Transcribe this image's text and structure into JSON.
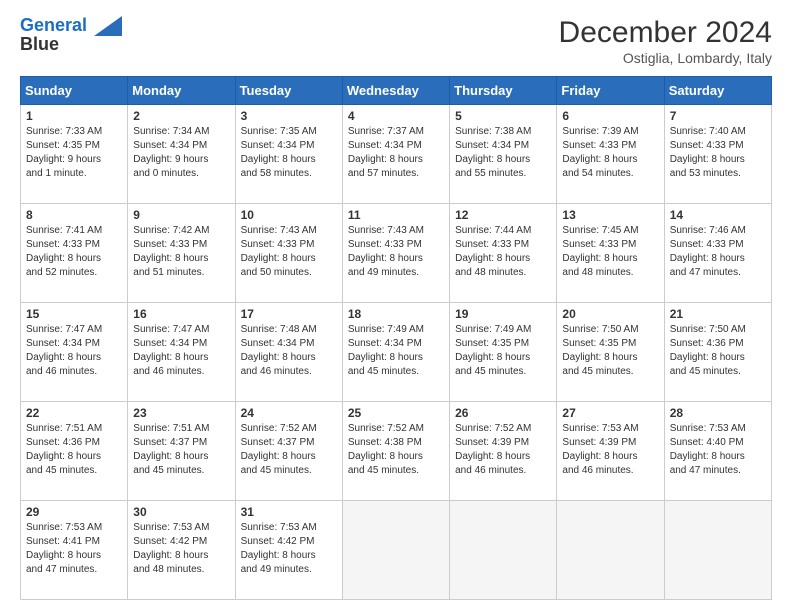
{
  "header": {
    "logo_line1": "General",
    "logo_line2": "Blue",
    "month": "December 2024",
    "location": "Ostiglia, Lombardy, Italy"
  },
  "weekdays": [
    "Sunday",
    "Monday",
    "Tuesday",
    "Wednesday",
    "Thursday",
    "Friday",
    "Saturday"
  ],
  "weeks": [
    [
      {
        "day": "1",
        "lines": [
          "Sunrise: 7:33 AM",
          "Sunset: 4:35 PM",
          "Daylight: 9 hours",
          "and 1 minute."
        ]
      },
      {
        "day": "2",
        "lines": [
          "Sunrise: 7:34 AM",
          "Sunset: 4:34 PM",
          "Daylight: 9 hours",
          "and 0 minutes."
        ]
      },
      {
        "day": "3",
        "lines": [
          "Sunrise: 7:35 AM",
          "Sunset: 4:34 PM",
          "Daylight: 8 hours",
          "and 58 minutes."
        ]
      },
      {
        "day": "4",
        "lines": [
          "Sunrise: 7:37 AM",
          "Sunset: 4:34 PM",
          "Daylight: 8 hours",
          "and 57 minutes."
        ]
      },
      {
        "day": "5",
        "lines": [
          "Sunrise: 7:38 AM",
          "Sunset: 4:34 PM",
          "Daylight: 8 hours",
          "and 55 minutes."
        ]
      },
      {
        "day": "6",
        "lines": [
          "Sunrise: 7:39 AM",
          "Sunset: 4:33 PM",
          "Daylight: 8 hours",
          "and 54 minutes."
        ]
      },
      {
        "day": "7",
        "lines": [
          "Sunrise: 7:40 AM",
          "Sunset: 4:33 PM",
          "Daylight: 8 hours",
          "and 53 minutes."
        ]
      }
    ],
    [
      {
        "day": "8",
        "lines": [
          "Sunrise: 7:41 AM",
          "Sunset: 4:33 PM",
          "Daylight: 8 hours",
          "and 52 minutes."
        ]
      },
      {
        "day": "9",
        "lines": [
          "Sunrise: 7:42 AM",
          "Sunset: 4:33 PM",
          "Daylight: 8 hours",
          "and 51 minutes."
        ]
      },
      {
        "day": "10",
        "lines": [
          "Sunrise: 7:43 AM",
          "Sunset: 4:33 PM",
          "Daylight: 8 hours",
          "and 50 minutes."
        ]
      },
      {
        "day": "11",
        "lines": [
          "Sunrise: 7:43 AM",
          "Sunset: 4:33 PM",
          "Daylight: 8 hours",
          "and 49 minutes."
        ]
      },
      {
        "day": "12",
        "lines": [
          "Sunrise: 7:44 AM",
          "Sunset: 4:33 PM",
          "Daylight: 8 hours",
          "and 48 minutes."
        ]
      },
      {
        "day": "13",
        "lines": [
          "Sunrise: 7:45 AM",
          "Sunset: 4:33 PM",
          "Daylight: 8 hours",
          "and 48 minutes."
        ]
      },
      {
        "day": "14",
        "lines": [
          "Sunrise: 7:46 AM",
          "Sunset: 4:33 PM",
          "Daylight: 8 hours",
          "and 47 minutes."
        ]
      }
    ],
    [
      {
        "day": "15",
        "lines": [
          "Sunrise: 7:47 AM",
          "Sunset: 4:34 PM",
          "Daylight: 8 hours",
          "and 46 minutes."
        ]
      },
      {
        "day": "16",
        "lines": [
          "Sunrise: 7:47 AM",
          "Sunset: 4:34 PM",
          "Daylight: 8 hours",
          "and 46 minutes."
        ]
      },
      {
        "day": "17",
        "lines": [
          "Sunrise: 7:48 AM",
          "Sunset: 4:34 PM",
          "Daylight: 8 hours",
          "and 46 minutes."
        ]
      },
      {
        "day": "18",
        "lines": [
          "Sunrise: 7:49 AM",
          "Sunset: 4:34 PM",
          "Daylight: 8 hours",
          "and 45 minutes."
        ]
      },
      {
        "day": "19",
        "lines": [
          "Sunrise: 7:49 AM",
          "Sunset: 4:35 PM",
          "Daylight: 8 hours",
          "and 45 minutes."
        ]
      },
      {
        "day": "20",
        "lines": [
          "Sunrise: 7:50 AM",
          "Sunset: 4:35 PM",
          "Daylight: 8 hours",
          "and 45 minutes."
        ]
      },
      {
        "day": "21",
        "lines": [
          "Sunrise: 7:50 AM",
          "Sunset: 4:36 PM",
          "Daylight: 8 hours",
          "and 45 minutes."
        ]
      }
    ],
    [
      {
        "day": "22",
        "lines": [
          "Sunrise: 7:51 AM",
          "Sunset: 4:36 PM",
          "Daylight: 8 hours",
          "and 45 minutes."
        ]
      },
      {
        "day": "23",
        "lines": [
          "Sunrise: 7:51 AM",
          "Sunset: 4:37 PM",
          "Daylight: 8 hours",
          "and 45 minutes."
        ]
      },
      {
        "day": "24",
        "lines": [
          "Sunrise: 7:52 AM",
          "Sunset: 4:37 PM",
          "Daylight: 8 hours",
          "and 45 minutes."
        ]
      },
      {
        "day": "25",
        "lines": [
          "Sunrise: 7:52 AM",
          "Sunset: 4:38 PM",
          "Daylight: 8 hours",
          "and 45 minutes."
        ]
      },
      {
        "day": "26",
        "lines": [
          "Sunrise: 7:52 AM",
          "Sunset: 4:39 PM",
          "Daylight: 8 hours",
          "and 46 minutes."
        ]
      },
      {
        "day": "27",
        "lines": [
          "Sunrise: 7:53 AM",
          "Sunset: 4:39 PM",
          "Daylight: 8 hours",
          "and 46 minutes."
        ]
      },
      {
        "day": "28",
        "lines": [
          "Sunrise: 7:53 AM",
          "Sunset: 4:40 PM",
          "Daylight: 8 hours",
          "and 47 minutes."
        ]
      }
    ],
    [
      {
        "day": "29",
        "lines": [
          "Sunrise: 7:53 AM",
          "Sunset: 4:41 PM",
          "Daylight: 8 hours",
          "and 47 minutes."
        ]
      },
      {
        "day": "30",
        "lines": [
          "Sunrise: 7:53 AM",
          "Sunset: 4:42 PM",
          "Daylight: 8 hours",
          "and 48 minutes."
        ]
      },
      {
        "day": "31",
        "lines": [
          "Sunrise: 7:53 AM",
          "Sunset: 4:42 PM",
          "Daylight: 8 hours",
          "and 49 minutes."
        ]
      },
      null,
      null,
      null,
      null
    ]
  ]
}
